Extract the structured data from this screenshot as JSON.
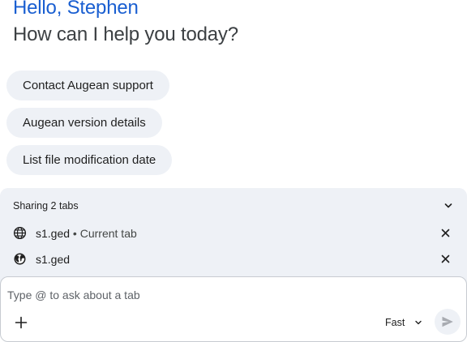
{
  "header": {
    "greeting": "Hello, Stephen",
    "subtitle": "How can I help you today?"
  },
  "suggestions": [
    {
      "label": "Contact Augean support"
    },
    {
      "label": "Augean version details"
    },
    {
      "label": "List file modification date"
    }
  ],
  "sharing": {
    "title": "Sharing 2 tabs",
    "tabs": [
      {
        "name": "s1.ged",
        "separator": " • ",
        "note": "Current tab",
        "icon": "globe-icon"
      },
      {
        "name": "s1.ged",
        "note": "",
        "icon": "earth-icon"
      }
    ]
  },
  "composer": {
    "placeholder": "Type @ to ask about a tab",
    "mode": "Fast"
  },
  "colors": {
    "accent": "#1a5fd1",
    "chip_bg": "#eef1f6",
    "border": "#c7cbd1"
  }
}
